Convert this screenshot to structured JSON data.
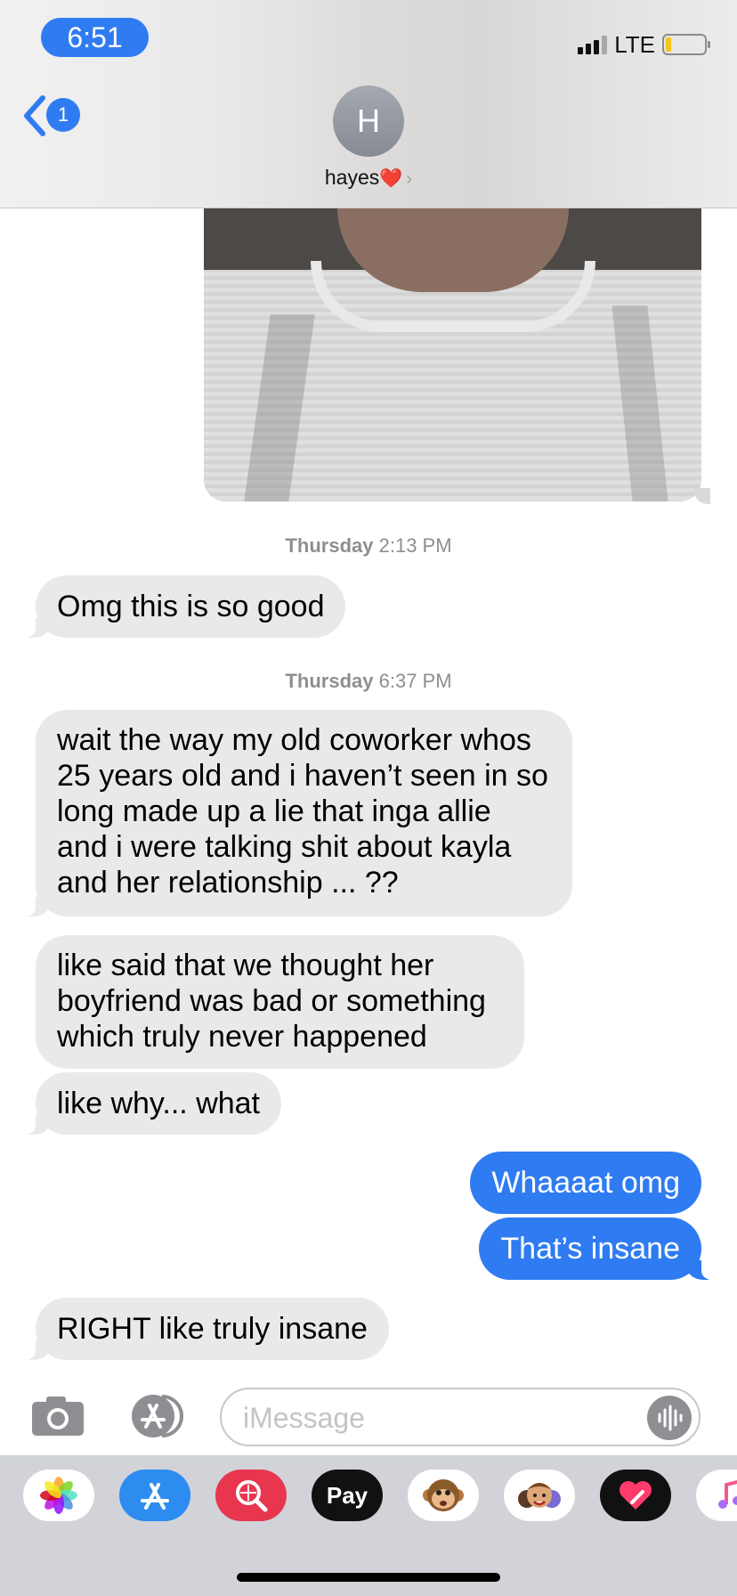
{
  "status_bar": {
    "time": "6:51",
    "network": "LTE"
  },
  "header": {
    "back_badge": "1",
    "avatar_initial": "H",
    "contact_name": "hayes"
  },
  "timestamps": [
    {
      "day": "Thursday",
      "time": "2:13 PM"
    },
    {
      "day": "Thursday",
      "time": "6:37 PM"
    }
  ],
  "messages": [
    {
      "direction": "incoming",
      "lines": [
        "Omg this is so good"
      ]
    },
    {
      "direction": "incoming",
      "lines": [
        "wait the way my old coworker whos",
        "25 years old and i haven’t seen in so",
        "long made up a lie that inga allie",
        "and i were talking shit about kayla",
        "and her relationship ...  ??"
      ]
    },
    {
      "direction": "incoming",
      "lines": [
        "like said that we thought her",
        "boyfriend was bad or something",
        "which truly never happened"
      ]
    },
    {
      "direction": "incoming",
      "lines": [
        "like why... what"
      ]
    },
    {
      "direction": "outgoing",
      "lines": [
        "Whaaaat omg"
      ]
    },
    {
      "direction": "outgoing",
      "lines": [
        "That’s insane"
      ]
    },
    {
      "direction": "incoming",
      "lines": [
        "RIGHT like truly insane"
      ]
    }
  ],
  "input": {
    "placeholder": "iMessage"
  },
  "app_drawer": {
    "apps": [
      {
        "name": "photos",
        "icon": "photos-icon"
      },
      {
        "name": "app-store",
        "icon": "app-store-icon"
      },
      {
        "name": "web-images",
        "icon": "image-search-icon"
      },
      {
        "name": "apple-pay",
        "icon": "apple-pay-icon",
        "label": "Pay"
      },
      {
        "name": "animoji",
        "icon": "monkey-icon"
      },
      {
        "name": "memoji",
        "icon": "memoji-icon"
      },
      {
        "name": "digital-touch",
        "icon": "heart-icon"
      },
      {
        "name": "music",
        "icon": "music-note-icon"
      }
    ]
  },
  "colors": {
    "accent": "#2f7bf2",
    "incoming_bubble": "#e9e9eb",
    "drawer": "#d1d3d9"
  }
}
